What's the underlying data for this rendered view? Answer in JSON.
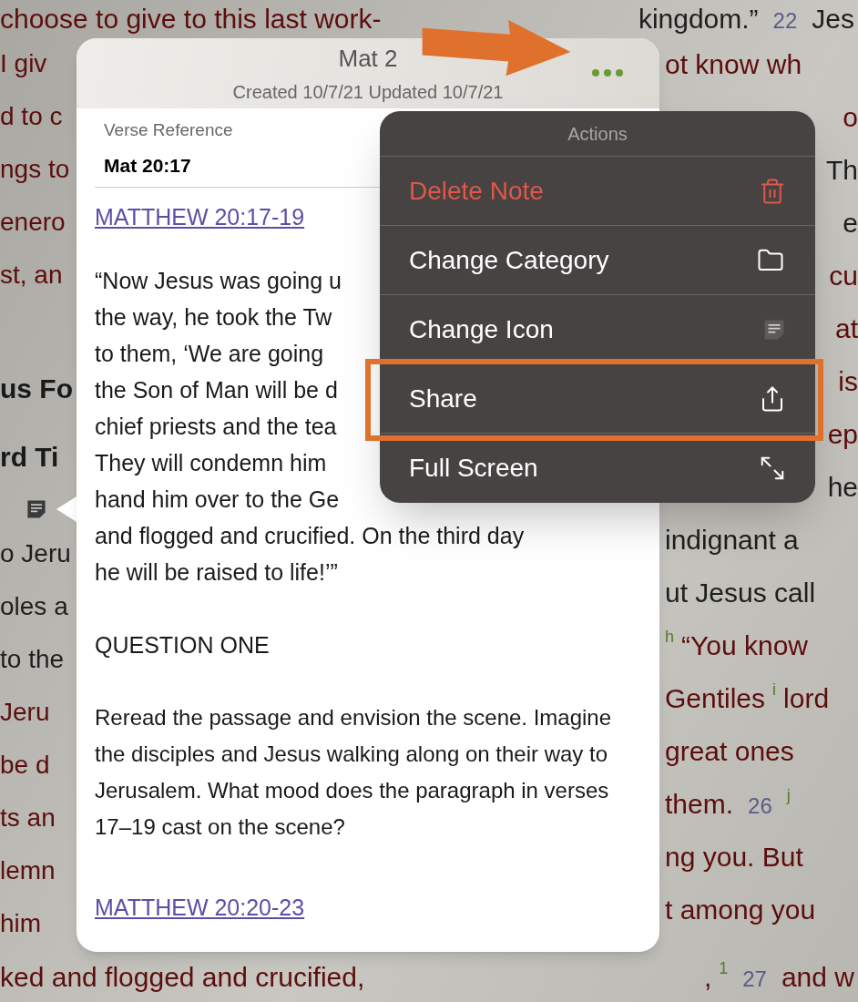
{
  "background": {
    "top_line": {
      "left": [
        {
          "text": "choose to give to this last work-",
          "kind": "red"
        }
      ],
      "right": [
        {
          "text": "kingdom.”",
          "kind": "black"
        },
        {
          "text": "22",
          "kind": "verse"
        },
        {
          "text": "Jes",
          "kind": "black"
        }
      ]
    },
    "left_lines": [
      {
        "kind": "red",
        "text": "I giv"
      },
      {
        "kind": "red",
        "text": "d to c"
      },
      {
        "kind": "red",
        "text": "ngs to"
      },
      {
        "kind": "red",
        "text": "enero"
      },
      {
        "kind": "red",
        "text": "st, an"
      },
      {
        "kind": "gap"
      },
      {
        "kind": "heading",
        "text": "us Fo"
      },
      {
        "kind": "heading",
        "text": "rd Ti"
      },
      {
        "kind": "note-icon"
      },
      {
        "kind": "black",
        "text": "o Jeru"
      },
      {
        "kind": "black",
        "text": "oles a"
      },
      {
        "kind": "black",
        "text": "to the"
      },
      {
        "kind": "red",
        "text": "Jeru"
      },
      {
        "kind": "red",
        "text": "be d"
      },
      {
        "kind": "red",
        "text": "ts an"
      },
      {
        "kind": "red",
        "text": "lemn"
      },
      {
        "kind": "red",
        "text": "him"
      }
    ],
    "right_lines": [
      {
        "kind": "full",
        "segments": [
          {
            "text": "ot know wh",
            "kind": "red"
          }
        ]
      },
      {
        "kind": "edge",
        "segments": [
          {
            "text": "o",
            "kind": "red"
          }
        ]
      },
      {
        "kind": "edge",
        "segments": [
          {
            "text": "Th",
            "kind": "black"
          }
        ]
      },
      {
        "kind": "edge",
        "segments": [
          {
            "text": "e",
            "kind": "black"
          }
        ]
      },
      {
        "kind": "edge",
        "segments": [
          {
            "text": "cu",
            "kind": "red"
          }
        ]
      },
      {
        "kind": "edge",
        "segments": [
          {
            "text": "at",
            "kind": "red"
          }
        ]
      },
      {
        "kind": "edge",
        "segments": [
          {
            "text": "is",
            "kind": "red"
          }
        ]
      },
      {
        "kind": "edge",
        "segments": [
          {
            "text": "ep",
            "kind": "red"
          }
        ]
      },
      {
        "kind": "edge",
        "segments": [
          {
            "text": "he",
            "kind": "black"
          }
        ]
      },
      {
        "kind": "full",
        "segments": [
          {
            "text": "indignant a",
            "kind": "black"
          }
        ]
      },
      {
        "kind": "full",
        "segments": [
          {
            "text": "ut Jesus call",
            "kind": "black"
          }
        ]
      },
      {
        "kind": "full",
        "segments": [
          {
            "text": "h",
            "kind": "note"
          },
          {
            "text": "“You know",
            "kind": "red"
          }
        ]
      },
      {
        "kind": "full",
        "segments": [
          {
            "text": "Gentiles",
            "kind": "red"
          },
          {
            "text": "i",
            "kind": "note"
          },
          {
            "text": "lord",
            "kind": "red"
          }
        ]
      },
      {
        "kind": "full",
        "segments": [
          {
            "text": "great ones",
            "kind": "red"
          }
        ]
      },
      {
        "kind": "full",
        "segments": [
          {
            "text": "them.",
            "kind": "red"
          },
          {
            "text": "26",
            "kind": "verse"
          },
          {
            "text": "j",
            "kind": "note"
          }
        ]
      },
      {
        "kind": "full",
        "segments": [
          {
            "text": "ng you. But",
            "kind": "red"
          }
        ]
      },
      {
        "kind": "full",
        "segments": [
          {
            "text": "t among you",
            "kind": "red"
          }
        ]
      }
    ],
    "bottom_line": {
      "left": [
        {
          "text": "ked and flogged and crucified,",
          "kind": "red"
        }
      ],
      "right": [
        {
          "text": ",",
          "kind": "red"
        },
        {
          "text": "1",
          "kind": "note"
        },
        {
          "text": "27",
          "kind": "verse"
        },
        {
          "text": "and w",
          "kind": "red"
        }
      ]
    }
  },
  "note": {
    "title": "Mat 2",
    "subtitle": "Created 10/7/21 Updated 10/7/21",
    "verse_reference": {
      "label": "Verse Reference",
      "value": "Mat 20:17"
    },
    "blocks": [
      {
        "kind": "link",
        "text": "MATTHEW 20:17-19"
      },
      {
        "kind": "lines",
        "lines": [
          "“Now Jesus was going u",
          "the way, he took the Tw",
          "to them, ‘We are going",
          "the Son of Man will be d",
          "chief priests and the tea",
          "They will condemn him",
          "hand him over to the Ge",
          "and flogged and crucified. On the third day",
          "he will be raised to life!’”"
        ]
      },
      {
        "kind": "heading",
        "text": "QUESTION ONE"
      },
      {
        "kind": "paragraph",
        "text": "Reread the passage and envision the scene. Imagine the disciples and Jesus walking along on their way to Jerusalem. What mood does the paragraph in verses 17–19 cast on the scene?"
      },
      {
        "kind": "link",
        "text": "MATTHEW 20:20-23"
      }
    ]
  },
  "menu": {
    "title": "Actions",
    "items": [
      {
        "label": "Delete Note",
        "kind": "delete",
        "destructive": true
      },
      {
        "label": "Change Category",
        "kind": "category",
        "destructive": false
      },
      {
        "label": "Change Icon",
        "kind": "icon",
        "destructive": false
      },
      {
        "label": "Share",
        "kind": "share",
        "destructive": false
      },
      {
        "label": "Full Screen",
        "kind": "fullscreen",
        "destructive": false
      }
    ]
  }
}
